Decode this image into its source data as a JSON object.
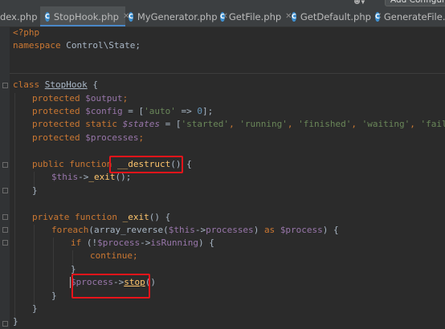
{
  "toolbar": {
    "user_icon": "user-icon",
    "add_configuration_label": "Add Configura"
  },
  "tabs": [
    {
      "label": "dex.php",
      "active": false
    },
    {
      "label": "StopHook.php",
      "active": true
    },
    {
      "label": "MyGenerator.php",
      "active": false
    },
    {
      "label": "GetFile.php",
      "active": false
    },
    {
      "label": "GetDefault.php",
      "active": false
    },
    {
      "label": "GenerateFile.php",
      "active": false
    }
  ],
  "code": {
    "l1": {
      "a": "<?php"
    },
    "l2": {
      "a": "namespace",
      "b": " Control\\State;"
    },
    "l5": {
      "a": "class",
      "b": " ",
      "c": "StopHook",
      "d": " {"
    },
    "l6": {
      "a": "protected",
      "b": " ",
      "c": "$output",
      "d": ";"
    },
    "l7": {
      "a": "protected",
      "b": " ",
      "c": "$config",
      "d": " = [",
      "e": "'auto'",
      "f": " => ",
      "g": "0",
      "h": "];"
    },
    "l8": {
      "a": "protected static",
      "b": " ",
      "c": "$states",
      "d": " = [",
      "e": "'started'",
      "f": ", ",
      "g": "'running'",
      "h": ", ",
      "i": "'finished'",
      "j": ", ",
      "k": "'waiting'",
      "l": ", ",
      "m": "'fail'",
      "n": "];"
    },
    "l9": {
      "a": "protected",
      "b": " ",
      "c": "$processes",
      "d": ";"
    },
    "l11": {
      "a": "public function",
      "b": " ",
      "c": "__destruct",
      "d": "() {"
    },
    "l12": {
      "a": "$this",
      "b": "->",
      "c": "_exit",
      "d": "();"
    },
    "l13": {
      "a": "}"
    },
    "l15": {
      "a": "private function",
      "b": " ",
      "c": "_exit",
      "d": "() {"
    },
    "l16": {
      "a": "foreach",
      "b": "(array_reverse(",
      "c": "$this",
      "d": "->",
      "e": "processes",
      "f": ") ",
      "g": "as",
      "h": " ",
      "i": "$process",
      "j": ") {"
    },
    "l17": {
      "a": "if",
      "b": " (!",
      "c": "$process",
      "d": "->",
      "e": "isRunning",
      "f": ") {"
    },
    "l18": {
      "a": "continue",
      "b": ";"
    },
    "l19": {
      "a": "}"
    },
    "l20": {
      "a": "$process",
      "b": "->",
      "c": "stop",
      "d": "()"
    },
    "l21": {
      "a": "}"
    },
    "l22": {
      "a": "}"
    },
    "l23": {
      "a": "}"
    }
  },
  "colors": {
    "background": "#2b2b2b",
    "keyword": "#cc7832",
    "variable": "#9876aa",
    "string": "#6a8759",
    "number": "#6897bb",
    "function": "#ffc66d",
    "highlight_box": "#e8141a"
  }
}
